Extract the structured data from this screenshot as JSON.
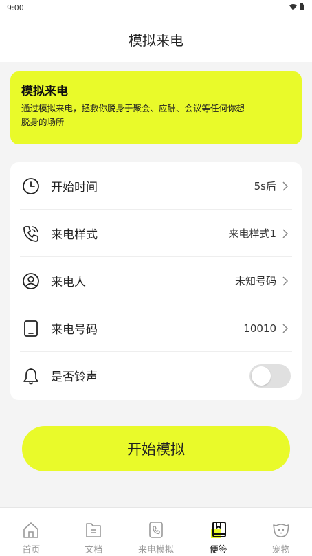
{
  "status_bar": {
    "time": "9:00"
  },
  "header": {
    "title": "模拟来电"
  },
  "banner": {
    "title": "模拟来电",
    "description_line1": "通过模拟来电，拯救你脱身于聚会、应酬、会议等任何你想",
    "description_line2": "脱身的场所"
  },
  "settings": {
    "start_time": {
      "label": "开始时间",
      "value": "5s后",
      "icon": "clock-icon"
    },
    "call_style": {
      "label": "来电样式",
      "value": "来电样式1",
      "icon": "phone-ringing-icon"
    },
    "caller": {
      "label": "来电人",
      "value": "未知号码",
      "icon": "user-icon"
    },
    "caller_number": {
      "label": "来电号码",
      "value": "10010",
      "icon": "tablet-icon"
    },
    "ringtone": {
      "label": "是否铃声",
      "enabled": false,
      "icon": "bell-icon"
    }
  },
  "actions": {
    "start_label": "开始模拟"
  },
  "nav": {
    "items": [
      {
        "label": "首页",
        "icon": "home-icon"
      },
      {
        "label": "文档",
        "icon": "document-icon"
      },
      {
        "label": "来电模拟",
        "icon": "phone-icon"
      },
      {
        "label": "便签",
        "icon": "notes-icon",
        "active": true
      },
      {
        "label": "宠物",
        "icon": "dog-icon"
      }
    ]
  },
  "colors": {
    "accent": "#e9fa2a",
    "background": "#f4f4f4",
    "toggle_off": "#e0e0e0"
  }
}
